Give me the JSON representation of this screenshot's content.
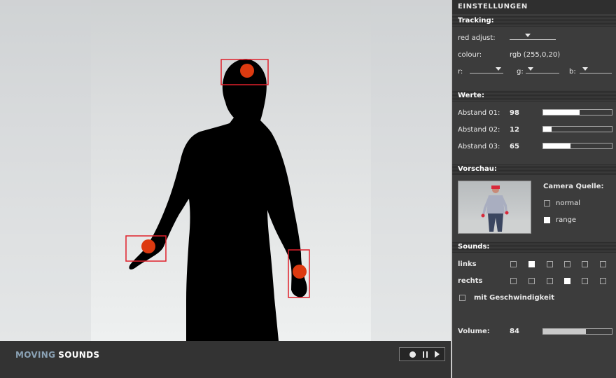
{
  "brand": {
    "word1": "MOVING",
    "word2": "SOUNDS"
  },
  "player": {
    "buttons": [
      "record",
      "pause",
      "play"
    ]
  },
  "tracking_markers": [
    "head",
    "left-hand",
    "right-hand"
  ],
  "colors": {
    "marker": "#dd3a10",
    "box": "#e0202a",
    "bar_fill": "#ffffff",
    "panel": "#3c3c3c"
  },
  "panel": {
    "title": "EINSTELLUNGEN",
    "tracking": {
      "heading": "Tracking:",
      "red_adjust_label": "red adjust:",
      "colour_label": "colour:",
      "colour_value": "rgb (255,0,20)",
      "r_label": "r:",
      "g_label": "g:",
      "b_label": "b:"
    },
    "werte": {
      "heading": "Werte:",
      "rows": [
        {
          "label": "Abstand 01:",
          "value": "98",
          "level": 0.53
        },
        {
          "label": "Abstand 02:",
          "value": "12",
          "level": 0.12
        },
        {
          "label": "Abstand 03:",
          "value": "65",
          "level": 0.4
        }
      ]
    },
    "vorschau": {
      "heading": "Vorschau:",
      "camera_label": "Camera Quelle:",
      "options": [
        {
          "label": "normal",
          "checked": false
        },
        {
          "label": "range",
          "checked": true
        }
      ]
    },
    "sounds": {
      "heading": "Sounds:",
      "links_label": "links",
      "links": [
        false,
        true,
        false,
        false,
        false,
        false
      ],
      "rechts_label": "rechts",
      "rechts": [
        false,
        false,
        false,
        true,
        false,
        false
      ],
      "speed_label": "mit Geschwindigkeit",
      "speed_checked": false,
      "volume_label": "Volume:",
      "volume_value": "84",
      "volume_level": 0.62
    }
  }
}
